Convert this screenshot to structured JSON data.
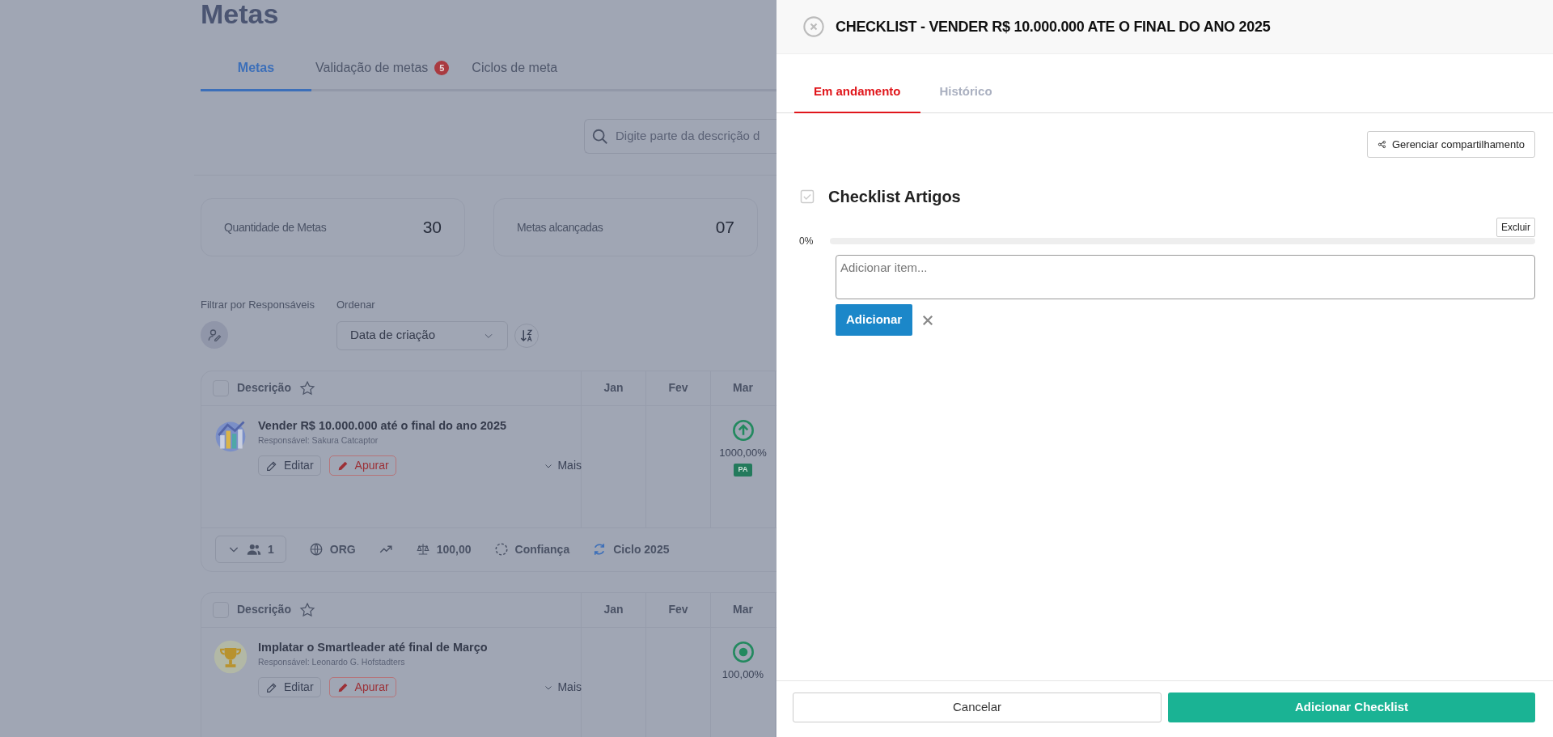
{
  "page": {
    "title": "Metas",
    "tabs": [
      {
        "label": "Metas",
        "selected": true
      },
      {
        "label": "Validação de metas",
        "selected": false,
        "badge": "5"
      },
      {
        "label": "Ciclos de meta",
        "selected": false
      }
    ],
    "search": {
      "placeholder": "Digite parte da descrição d"
    },
    "stats": [
      {
        "label": "Quantidade de Metas",
        "value": "30"
      },
      {
        "label": "Metas alcançadas",
        "value": "07"
      }
    ],
    "filters": {
      "responsaveis_label": "Filtrar por Responsáveis",
      "order_label": "Ordenar",
      "order_value": "Data de criação"
    },
    "goals": [
      {
        "columns": [
          "Descrição",
          "Jan",
          "Fev",
          "Mar"
        ],
        "kind": "chart",
        "checked": false,
        "title": "Vender R$ 10.000.000 até o final do ano 2025",
        "responsible": "Responsável: Sakura Catcaptor",
        "edit": "Editar",
        "measure": "Apurar",
        "more": "Mais",
        "mar": {
          "kind": "up",
          "value": "1000,00%",
          "tag": "PA"
        },
        "footer": {
          "members": "1",
          "scope": "ORG",
          "weight": "100,00",
          "confidence": "Confiança",
          "cycle": "Ciclo 2025"
        }
      },
      {
        "columns": [
          "Descrição",
          "Jan",
          "Fev",
          "Mar"
        ],
        "kind": "trophy",
        "checked": false,
        "title": "Implatar o Smartleader até final de Março",
        "responsible": "Responsável: Leonardo G. Hofstadters",
        "edit": "Editar",
        "measure": "Apurar",
        "more": "Mais",
        "mar": {
          "kind": "target",
          "value": "100,00%"
        }
      }
    ]
  },
  "panel": {
    "title": "CHECKLIST - VENDER R$ 10.000.000 ATE O FINAL DO ANO 2025",
    "tabs": [
      {
        "label": "Em andamento",
        "selected": true
      },
      {
        "label": "Histórico",
        "selected": false
      }
    ],
    "share_button": "Gerenciar compartilhamento",
    "checklist": {
      "title": "Checklist Artigos",
      "delete": "Excluir",
      "percent": "0%",
      "level": 0,
      "input_placeholder": "Adicionar item...",
      "add": "Adicionar"
    },
    "footer": {
      "cancel": "Cancelar",
      "submit": "Adicionar Checklist"
    }
  }
}
